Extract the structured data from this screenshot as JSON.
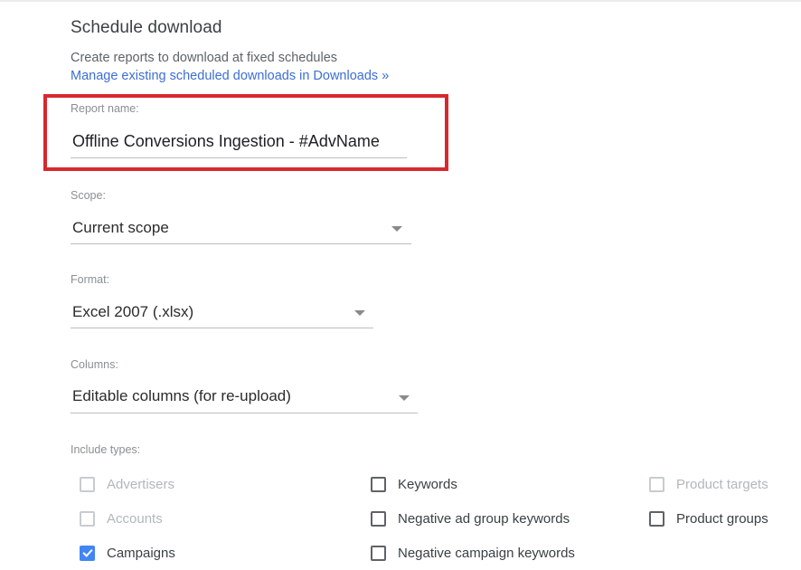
{
  "page": {
    "title": "Schedule download",
    "subtitle": "Create reports to download at fixed schedules",
    "manage_link": "Manage existing scheduled downloads in Downloads »"
  },
  "colors": {
    "accent_blue": "#4285f4",
    "link_blue": "#3b6fd4",
    "highlight_red": "#d8282f",
    "text_primary": "#3c4043",
    "text_muted": "#8b8f93",
    "text_disabled": "#b3b7bb"
  },
  "fields": {
    "report_name": {
      "label": "Report name:",
      "value": "Offline Conversions Ingestion - #AdvName",
      "placeholder": "Report name"
    },
    "scope": {
      "label": "Scope:",
      "value": "Current scope",
      "caret_icon": "chevron-down-icon"
    },
    "format": {
      "label": "Format:",
      "value": "Excel 2007 (.xlsx)",
      "caret_icon": "chevron-down-icon"
    },
    "columns": {
      "label": "Columns:",
      "value": "Editable columns (for re-upload)",
      "caret_icon": "chevron-down-icon"
    }
  },
  "include_types": {
    "label": "Include types:",
    "columns": [
      [
        {
          "label": "Advertisers",
          "checked": false,
          "disabled": true
        },
        {
          "label": "Accounts",
          "checked": false,
          "disabled": true
        },
        {
          "label": "Campaigns",
          "checked": true,
          "disabled": false
        }
      ],
      [
        {
          "label": "Keywords",
          "checked": false,
          "disabled": false
        },
        {
          "label": "Negative ad group keywords",
          "checked": false,
          "disabled": false
        },
        {
          "label": "Negative campaign keywords",
          "checked": false,
          "disabled": false
        }
      ],
      [
        {
          "label": "Product targets",
          "checked": false,
          "disabled": true
        },
        {
          "label": "Product groups",
          "checked": false,
          "disabled": false
        }
      ]
    ]
  }
}
